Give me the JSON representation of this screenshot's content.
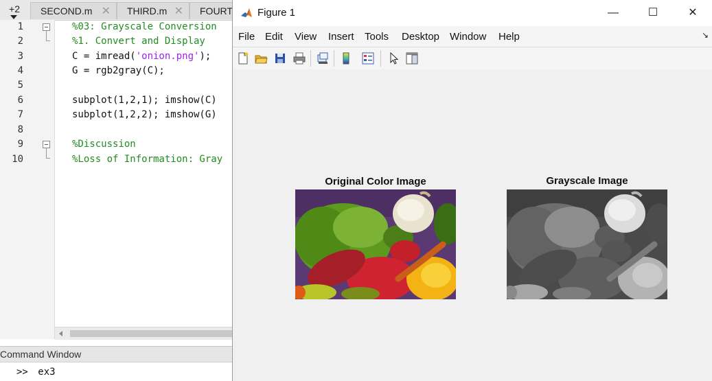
{
  "editor": {
    "tabs": [
      {
        "label": "+2"
      },
      {
        "label": "SECOND.m"
      },
      {
        "label": "THIRD.m"
      },
      {
        "label": "FOURTH"
      }
    ],
    "lines": [
      {
        "num": "1",
        "text": "%03: Grayscale Conversion"
      },
      {
        "num": "2",
        "text": "%1. Convert and Display"
      },
      {
        "num": "3",
        "prefix": "C = imread(",
        "string": "'onion.png'",
        "suffix": ");"
      },
      {
        "num": "4",
        "text": "G = rgb2gray(C);"
      },
      {
        "num": "5",
        "text": ""
      },
      {
        "num": "6",
        "text": "subplot(1,2,1); imshow(C)"
      },
      {
        "num": "7",
        "text": "subplot(1,2,2); imshow(G)"
      },
      {
        "num": "8",
        "text": ""
      },
      {
        "num": "9",
        "text": "%Discussion"
      },
      {
        "num": "10",
        "text": "%Loss of Information: Gray"
      }
    ]
  },
  "command_window": {
    "title": "Command Window",
    "prompt": ">>",
    "command": "ex3"
  },
  "figure": {
    "title": "Figure 1",
    "menus": [
      "File",
      "Edit",
      "View",
      "Insert",
      "Tools",
      "Desktop",
      "Window",
      "Help"
    ],
    "toolbar_icons": [
      "new-figure-icon",
      "open-file-icon",
      "save-icon",
      "print-icon",
      "link-plot-icon",
      "insert-colorbar-icon",
      "insert-legend-icon",
      "pointer-icon",
      "property-inspector-icon"
    ],
    "subplots": [
      {
        "title": "Original Color Image"
      },
      {
        "title": "Grayscale Image"
      }
    ]
  },
  "window_buttons": {
    "minimize": "—",
    "maximize": "☐",
    "close": "✕"
  }
}
